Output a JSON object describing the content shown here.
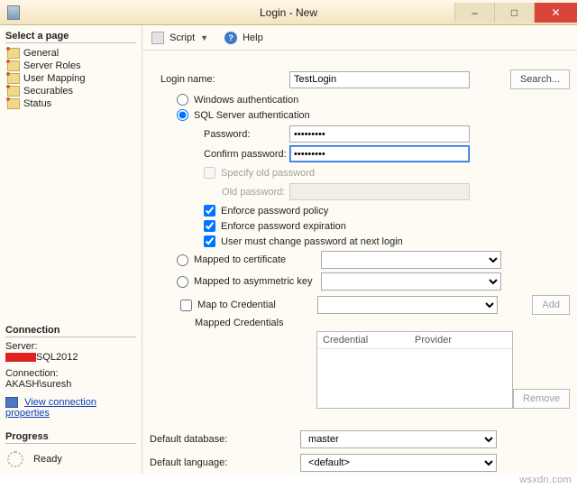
{
  "titlebar": {
    "title": "Login - New"
  },
  "sidebar": {
    "select_page_header": "Select a page",
    "pages": [
      "General",
      "Server Roles",
      "User Mapping",
      "Securables",
      "Status"
    ],
    "connection_header": "Connection",
    "server_label": "Server:",
    "server_value": "SQL2012",
    "connection_label": "Connection:",
    "connection_value": "AKASH\\suresh",
    "view_props": "View connection properties",
    "progress_header": "Progress",
    "progress_status": "Ready"
  },
  "toolbar": {
    "script": "Script",
    "help": "Help"
  },
  "form": {
    "login_name_label": "Login name:",
    "login_name_value": "TestLogin",
    "search_btn": "Search...",
    "auth": {
      "windows": "Windows authentication",
      "sql": "SQL Server authentication",
      "selected": "sql"
    },
    "password_label": "Password:",
    "password_value": "•••••••••",
    "confirm_label": "Confirm password:",
    "confirm_value": "•••••••••",
    "specify_old": "Specify old password",
    "old_password_label": "Old password:",
    "enforce_policy": "Enforce password policy",
    "enforce_expiration": "Enforce password expiration",
    "must_change": "User must change password at next login",
    "mapped_cert": "Mapped to certificate",
    "mapped_asym": "Mapped to asymmetric key",
    "map_to_cred": "Map to Credential",
    "add_btn": "Add",
    "mapped_credentials": "Mapped Credentials",
    "cred_head_credential": "Credential",
    "cred_head_provider": "Provider",
    "remove_btn": "Remove"
  },
  "bottom": {
    "default_db_label": "Default database:",
    "default_db_value": "master",
    "default_lang_label": "Default language:",
    "default_lang_value": "<default>"
  },
  "watermark": "wsxdn.com"
}
